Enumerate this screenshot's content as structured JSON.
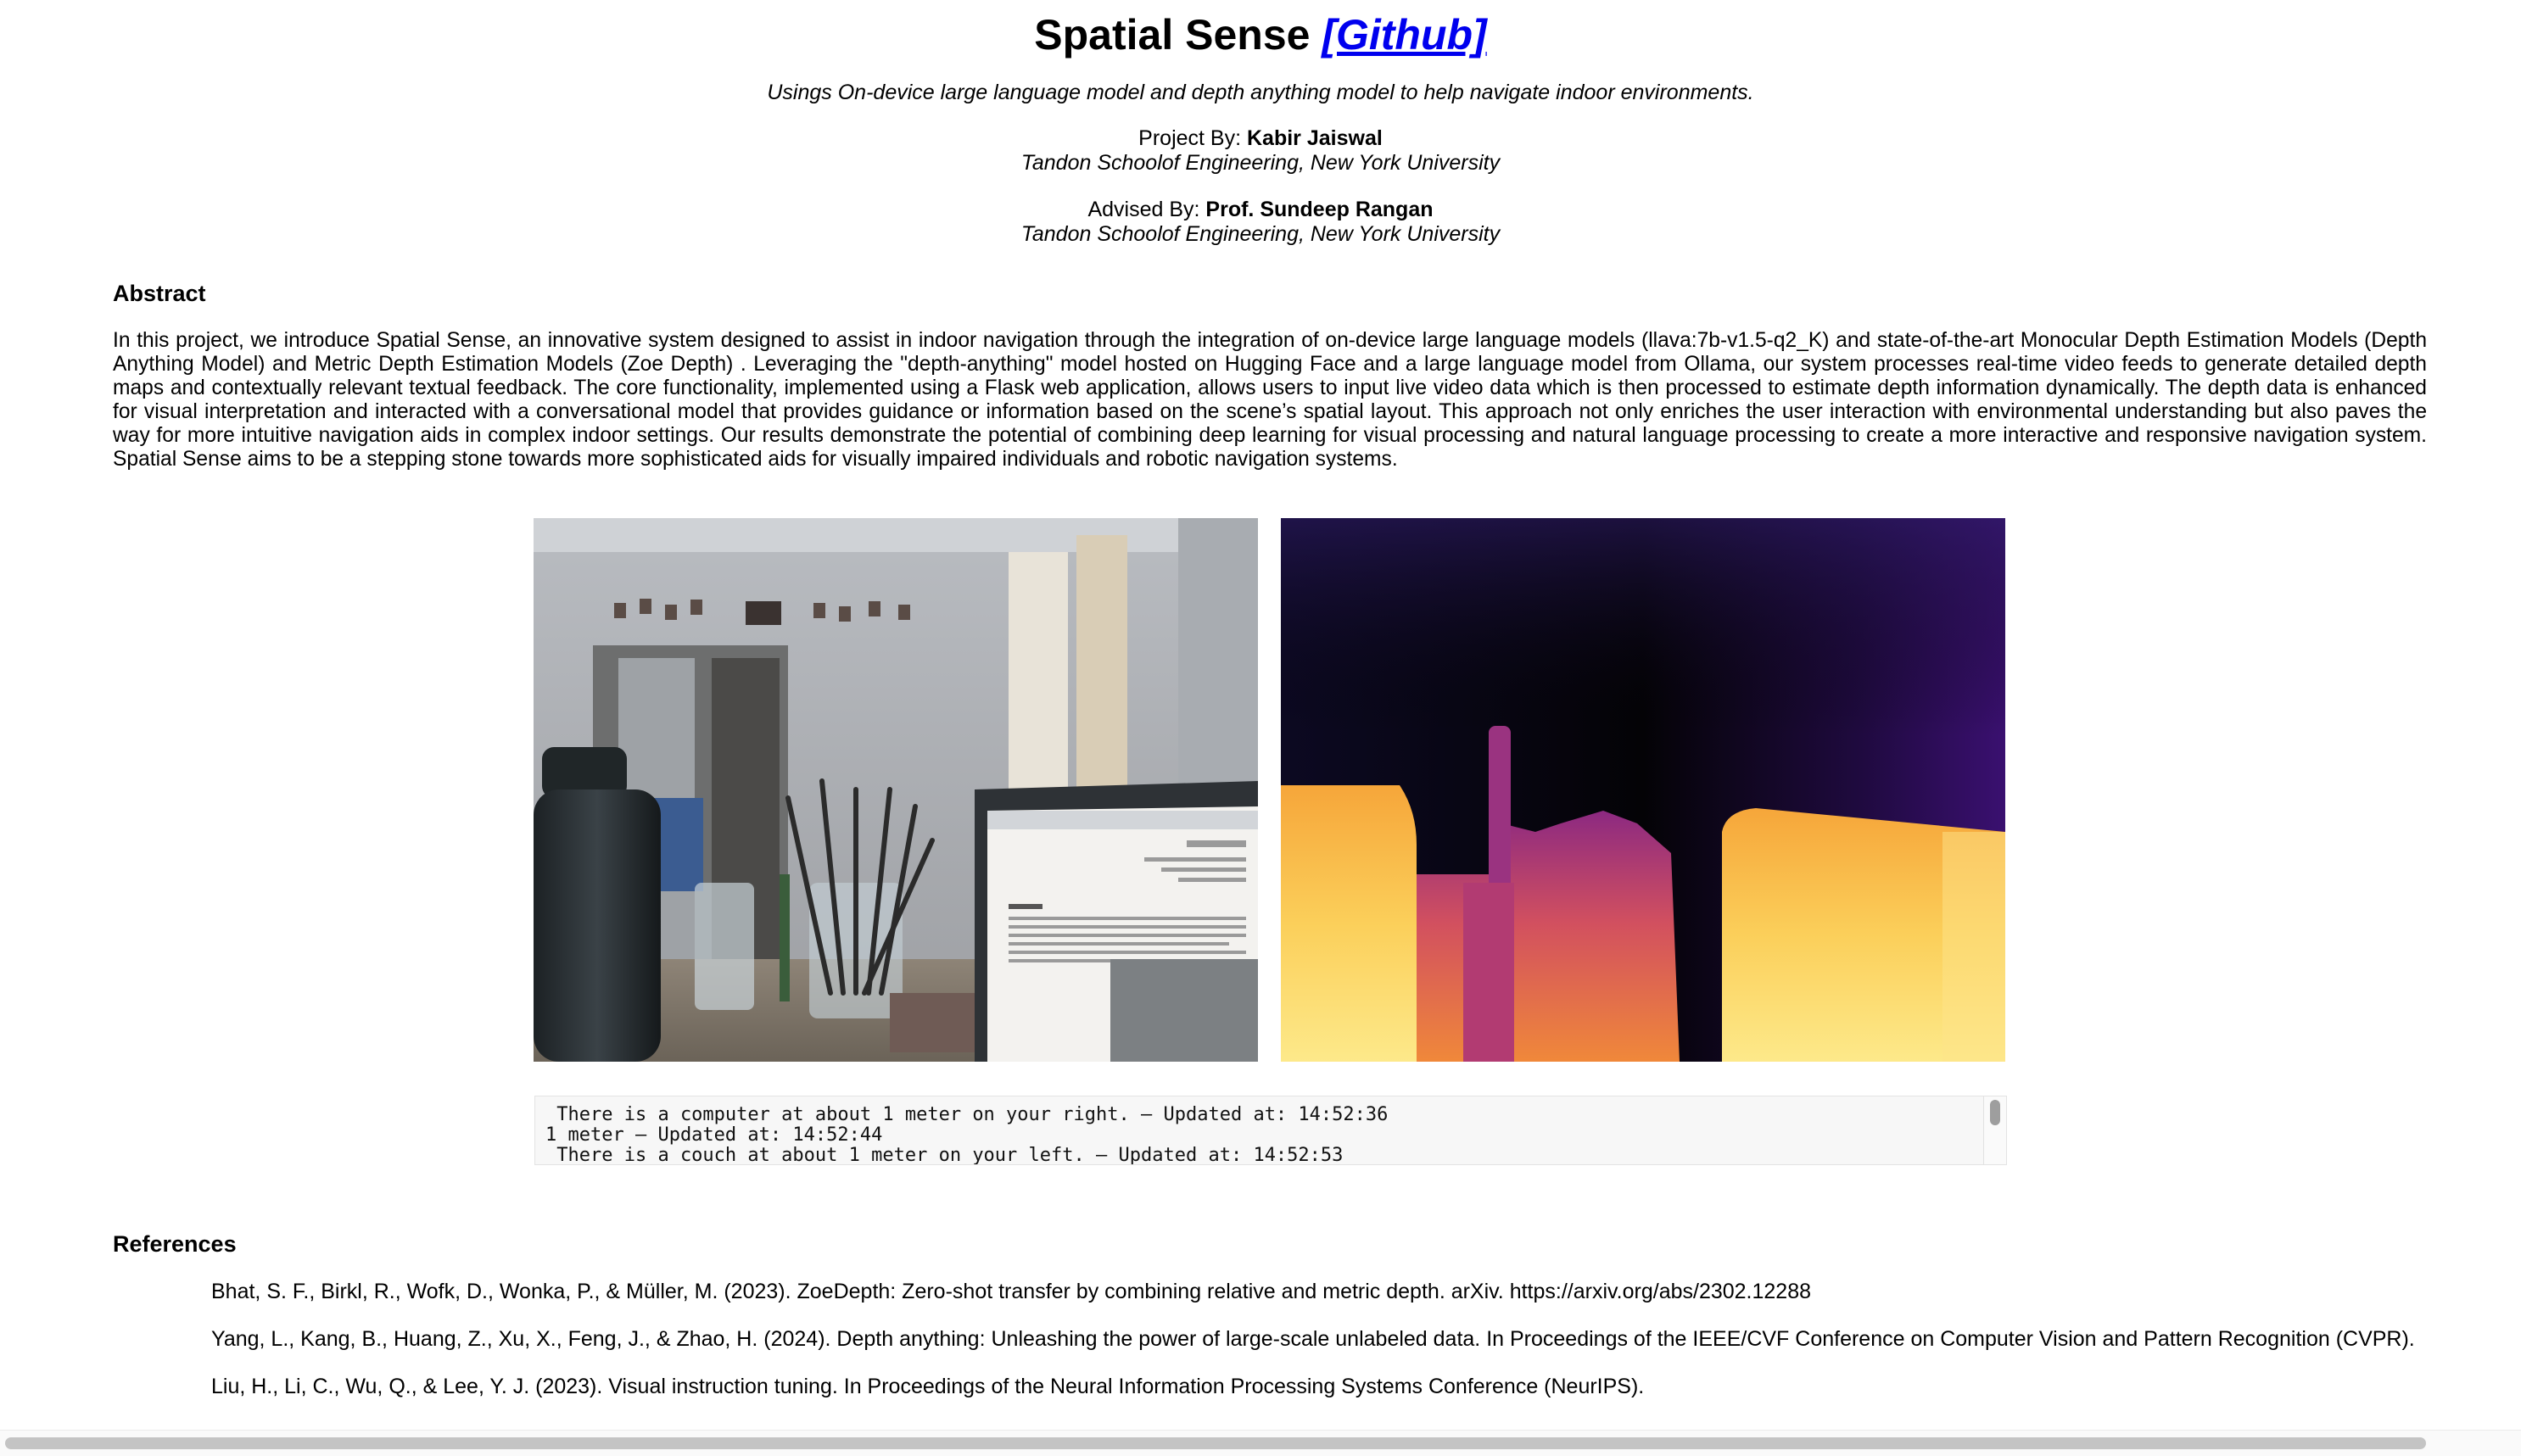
{
  "header": {
    "title": "Spatial Sense",
    "github_link": "[Github]",
    "subtitle": "Usings On-device large language model and depth anything model to help navigate indoor environments."
  },
  "project": {
    "label": "Project By: ",
    "name": "Kabir Jaiswal",
    "institution": "Tandon Schoolof Engineering, New York University"
  },
  "advisor": {
    "label": "Advised By: ",
    "name": "Prof. Sundeep Rangan",
    "institution": "Tandon Schoolof Engineering, New York University"
  },
  "abstract": {
    "heading": "Abstract",
    "text": "In this project, we introduce Spatial Sense, an innovative system designed to assist in indoor navigation through the integration of on-device large language models (llava:7b-v1.5-q2_K) and state-of-the-art Monocular Depth Estimation Models (Depth Anything Model) and Metric Depth Estimation Models (Zoe Depth) . Leveraging the \"depth-anything\" model hosted on Hugging Face and a large language model from Ollama, our system processes real-time video feeds to generate detailed depth maps and contextually relevant textual feedback. The core functionality, implemented using a Flask web application, allows users to input live video data which is then processed to estimate depth information dynamically. The depth data is enhanced for visual interpretation and interacted with a conversational model that provides guidance or information based on the scene’s spatial layout. This approach not only enriches the user interaction with environmental understanding but also paves the way for more intuitive navigation aids in complex indoor settings. Our results demonstrate the potential of combining deep learning for visual processing and natural language processing to create a more interactive and responsive navigation system. Spatial Sense aims to be a stepping stone towards more sophisticated aids for visually impaired individuals and robotic navigation systems."
  },
  "media": {
    "rgb_frame": "camera-frame",
    "depth_frame": "depth-map",
    "depth_colormap": [
      "#0a0a24",
      "#3b0f70",
      "#8c2981",
      "#de4968",
      "#f66e3c",
      "#fba238",
      "#fcfdbf"
    ]
  },
  "log": {
    "lines": [
      " There is a computer at about 1 meter on your right. – Updated at: 14:52:36",
      "1 meter – Updated at: 14:52:44",
      " There is a couch at about 1 meter on your left. – Updated at: 14:52:53"
    ]
  },
  "references": {
    "heading": "References",
    "items": [
      "Bhat, S. F., Birkl, R., Wofk, D., Wonka, P., & Müller, M. (2023). ZoeDepth: Zero-shot transfer by combining relative and metric depth. arXiv. https://arxiv.org/abs/2302.12288",
      "Yang, L., Kang, B., Huang, Z., Xu, X., Feng, J., & Zhao, H. (2024). Depth anything: Unleashing the power of large-scale unlabeled data. In Proceedings of the IEEE/CVF Conference on Computer Vision and Pattern Recognition (CVPR).",
      "Liu, H., Li, C., Wu, Q., & Lee, Y. J. (2023). Visual instruction tuning. In Proceedings of the Neural Information Processing Systems Conference (NeurIPS)."
    ]
  }
}
